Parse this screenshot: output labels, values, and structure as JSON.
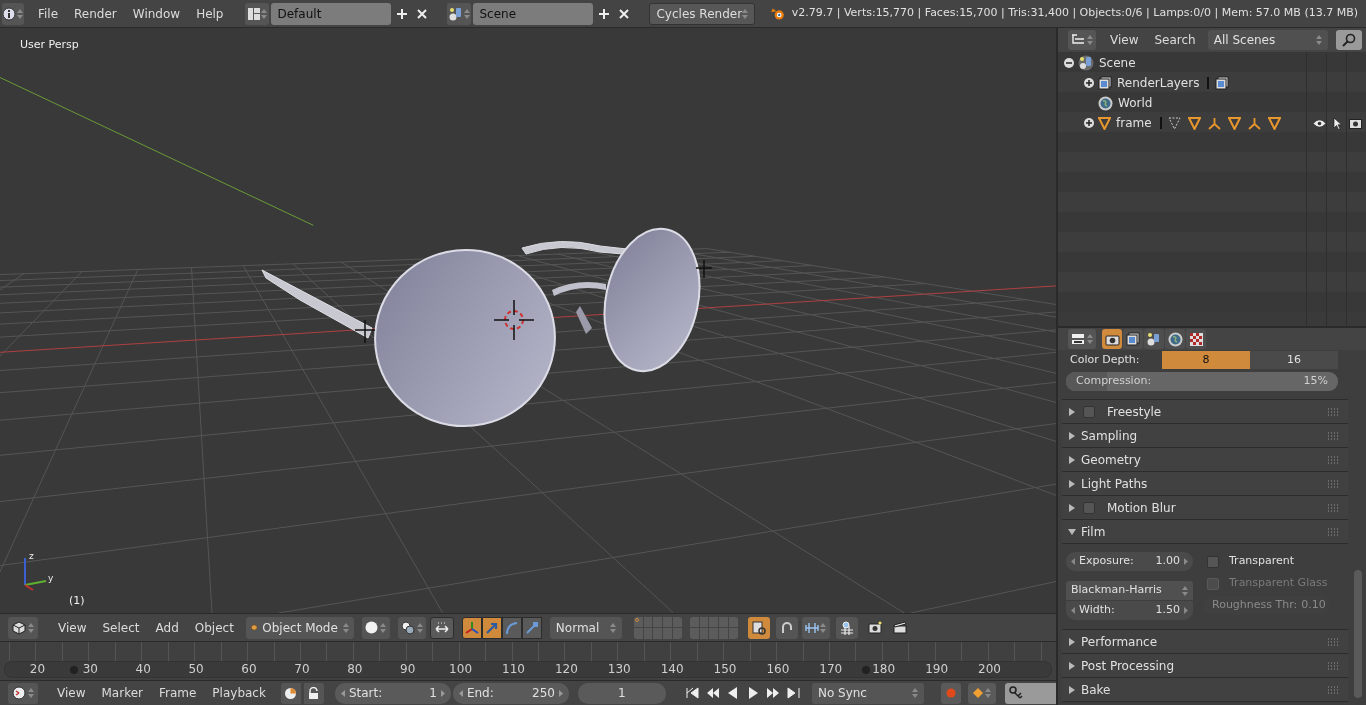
{
  "top_bar": {
    "menus": [
      "File",
      "Render",
      "Window",
      "Help"
    ],
    "screen_layout": "Default",
    "scene": "Scene",
    "render_engine": "Cycles Render",
    "stats": "v2.79.7 | Verts:15,770 | Faces:15,700 | Tris:31,400 | Objects:0/6 | Lamps:0/0 | Mem: 57.0 MB (13.7 MB)"
  },
  "viewport": {
    "view_name": "User Persp",
    "frame": "(1)",
    "axis_labels": [
      "z",
      "y"
    ]
  },
  "viewport_header": {
    "menus": [
      "View",
      "Select",
      "Add",
      "Object"
    ],
    "mode": "Object Mode",
    "manipulator_on": true,
    "manipulators": [
      {
        "kind": "translate",
        "selected": true
      },
      {
        "kind": "rotate",
        "selected": false
      },
      {
        "kind": "scale",
        "selected": false
      }
    ],
    "orientation": "Normal",
    "layers": [
      {
        "has_objects": true
      },
      {
        "has_objects": false
      },
      {
        "has_objects": false
      },
      {
        "has_objects": false
      },
      {
        "has_objects": false
      },
      {
        "has_objects": false
      },
      {
        "has_objects": false
      },
      {
        "has_objects": false
      },
      {
        "has_objects": false
      },
      {
        "has_objects": false
      },
      {
        "has_objects": false
      },
      {
        "has_objects": false
      },
      {
        "has_objects": false
      },
      {
        "has_objects": false
      },
      {
        "has_objects": false
      },
      {
        "has_objects": false
      },
      {
        "has_objects": false
      },
      {
        "has_objects": false
      },
      {
        "has_objects": false
      },
      {
        "has_objects": false
      }
    ],
    "lock_camera_on": true
  },
  "timeline": {
    "ticks": [
      "20",
      "30",
      "40",
      "50",
      "60",
      "70",
      "80",
      "90",
      "100",
      "110",
      "120",
      "130",
      "140",
      "150",
      "160",
      "170",
      "180",
      "190",
      "200"
    ]
  },
  "timeline_header": {
    "menus": [
      "View",
      "Marker",
      "Frame",
      "Playback"
    ],
    "start": {
      "label": "Start:",
      "value": "1"
    },
    "end": {
      "label": "End:",
      "value": "250"
    },
    "current_frame": "1",
    "sync": "No Sync"
  },
  "outliner": {
    "menus": [
      "View",
      "Search"
    ],
    "display_mode": "All Scenes",
    "tree": [
      {
        "kind": "scene",
        "name": "Scene",
        "expanded": true,
        "children": [
          {
            "kind": "render_layers",
            "name": "RenderLayers",
            "expanded": false
          },
          {
            "kind": "world",
            "name": "World"
          },
          {
            "kind": "object",
            "name": "frame",
            "expanded": false,
            "visible": true,
            "selectable": true,
            "renderable": true
          }
        ]
      }
    ]
  },
  "properties": {
    "tabs": [
      {
        "kind": "render",
        "selected": true
      },
      {
        "kind": "render_layers",
        "selected": false
      },
      {
        "kind": "scene",
        "selected": false
      },
      {
        "kind": "world",
        "selected": false
      },
      {
        "kind": "texture",
        "selected": false
      }
    ],
    "color_depth": {
      "label": "Color Depth:",
      "options": [
        {
          "label": "8",
          "selected": true
        },
        {
          "label": "16",
          "selected": false
        }
      ]
    },
    "compression": {
      "label": "Compression:",
      "value": "15%",
      "level": 0.15
    },
    "panels": [
      {
        "title": "Freestyle",
        "expanded": false,
        "checked": false
      },
      {
        "title": "Sampling",
        "expanded": false
      },
      {
        "title": "Geometry",
        "expanded": false
      },
      {
        "title": "Light Paths",
        "expanded": false
      },
      {
        "title": "Motion Blur",
        "expanded": false,
        "checked": false
      },
      {
        "title": "Film",
        "expanded": true
      },
      {
        "title": "Performance",
        "expanded": false
      },
      {
        "title": "Post Processing",
        "expanded": false
      },
      {
        "title": "Bake",
        "expanded": false
      }
    ],
    "film": {
      "exposure": {
        "label": "Exposure:",
        "value": "1.00"
      },
      "transparent": {
        "label": "Transparent",
        "checked": false,
        "disabled": false
      },
      "filter_type": "Blackman-Harris",
      "width": {
        "label": "Width:",
        "value": "1.50"
      },
      "transparent_glass": {
        "label": "Transparent Glass",
        "checked": false,
        "disabled": true
      },
      "roughness": {
        "label": "Roughness Thr:",
        "value": "0.10",
        "disabled": true
      }
    }
  }
}
